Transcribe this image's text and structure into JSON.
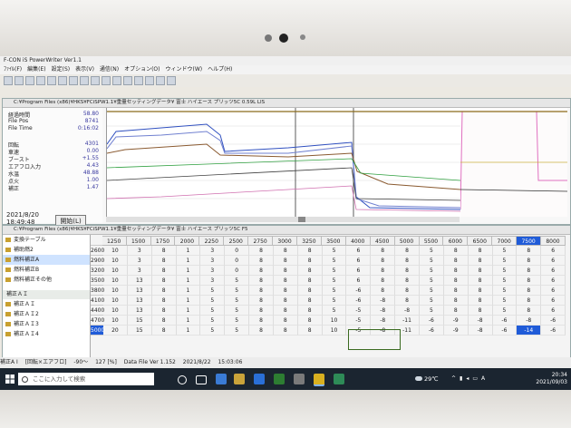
{
  "app": {
    "title": "F-CON iS PowerWriter Ver1.1",
    "menu": [
      "ﾌｧｲﾙ(F)",
      "編集(E)",
      "設定(S)",
      "表示(V)",
      "通信(N)",
      "オプション(O)",
      "ウィンドウ(W)",
      "ヘルプ(H)"
    ]
  },
  "monitor_window": {
    "title": "C:¥Program Files (x86)¥HKS¥FCiSPW1.1¥重量セッティングデータ¥ 富士 ハイエース プリッツ5C 0.59L LIS",
    "params": [
      {
        "label": "経過時間",
        "value": "58.80"
      },
      {
        "label": "File Pos",
        "value": "8741"
      },
      {
        "label": "File Time",
        "value": "0:16:02"
      },
      {
        "label": "回転",
        "value": "4301"
      },
      {
        "label": "車速",
        "value": "0.00"
      },
      {
        "label": "ブースト",
        "value": "+1.55"
      },
      {
        "label": "エアフロ入力",
        "value": "4.43"
      },
      {
        "label": "水温",
        "value": "48.88"
      },
      {
        "label": "点火",
        "value": "1.00"
      },
      {
        "label": "補正",
        "value": "1.47"
      }
    ],
    "date": "2021/8/20",
    "time": "18:49:48",
    "start_label": "開始(L)"
  },
  "map_window": {
    "title": "C:¥Program Files (x86)¥HKS¥FCiSPW1.1¥重量セッティングデータ¥ 富士 ハイエース プリッツ5C F5",
    "tree": [
      "変換テーブル",
      "補助燃2",
      "燃料補正A",
      "燃料補正B",
      "燃料補正その他"
    ],
    "tree_section": "補正ＡＩ",
    "tree_sub": [
      "補正ＡＩ",
      "補正ＡＩ2",
      "補正ＡＩ3",
      "補正ＡＩ4"
    ],
    "columns": [
      "1250",
      "1500",
      "1750",
      "2000",
      "2250",
      "2500",
      "2750",
      "3000",
      "3250",
      "3500",
      "4000",
      "4500",
      "5000",
      "5500",
      "6000",
      "6500",
      "7000",
      "7500",
      "8000"
    ],
    "rows": [
      {
        "label": "2600",
        "cells": [
          "10",
          "3",
          "8",
          "1",
          "3",
          "0",
          "8",
          "8",
          "8",
          "5",
          "6",
          "8",
          "8",
          "5",
          "8",
          "8",
          "5",
          "8",
          "6"
        ]
      },
      {
        "label": "2900",
        "cells": [
          "10",
          "3",
          "8",
          "1",
          "3",
          "0",
          "8",
          "8",
          "8",
          "5",
          "6",
          "8",
          "8",
          "5",
          "8",
          "8",
          "5",
          "8",
          "6"
        ]
      },
      {
        "label": "3200",
        "cells": [
          "10",
          "3",
          "8",
          "1",
          "3",
          "0",
          "8",
          "8",
          "8",
          "5",
          "6",
          "8",
          "8",
          "5",
          "8",
          "8",
          "5",
          "8",
          "6"
        ]
      },
      {
        "label": "3500",
        "cells": [
          "10",
          "13",
          "8",
          "1",
          "3",
          "5",
          "8",
          "8",
          "8",
          "5",
          "6",
          "8",
          "8",
          "5",
          "8",
          "8",
          "5",
          "8",
          "6"
        ]
      },
      {
        "label": "3800",
        "cells": [
          "10",
          "13",
          "8",
          "1",
          "5",
          "5",
          "8",
          "8",
          "8",
          "5",
          "-6",
          "8",
          "8",
          "5",
          "8",
          "8",
          "5",
          "8",
          "6"
        ]
      },
      {
        "label": "4100",
        "cells": [
          "10",
          "13",
          "8",
          "1",
          "5",
          "5",
          "8",
          "8",
          "8",
          "5",
          "-6",
          "-8",
          "8",
          "5",
          "8",
          "8",
          "5",
          "8",
          "6"
        ]
      },
      {
        "label": "4400",
        "cells": [
          "10",
          "13",
          "8",
          "1",
          "5",
          "5",
          "8",
          "8",
          "8",
          "5",
          "-5",
          "-8",
          "-8",
          "5",
          "8",
          "8",
          "5",
          "8",
          "6"
        ]
      },
      {
        "label": "4700",
        "cells": [
          "10",
          "15",
          "8",
          "1",
          "5",
          "5",
          "8",
          "8",
          "8",
          "10",
          "-5",
          "-8",
          "-11",
          "-6",
          "-9",
          "-8",
          "-6",
          "-8",
          "-6"
        ]
      },
      {
        "label": "5000",
        "cells": [
          "20",
          "15",
          "8",
          "1",
          "5",
          "5",
          "8",
          "8",
          "8",
          "10",
          "-5",
          "-8",
          "-11",
          "-6",
          "-9",
          "-8",
          "-6",
          "-14",
          "-6"
        ]
      }
    ],
    "selected_column": "7500",
    "selected_row": "5000"
  },
  "status": {
    "items": [
      "補正A I",
      "[回転×エアフロ]",
      "-90～",
      "127 [%]",
      "Data File Ver 1.152",
      "2021/8/22",
      "15:03:06"
    ]
  },
  "taskbar": {
    "search_placeholder": "ここに入力して検索",
    "weather": "29℃",
    "ime": "A",
    "clock_time": "20:34",
    "clock_date": "2021/09/03"
  }
}
